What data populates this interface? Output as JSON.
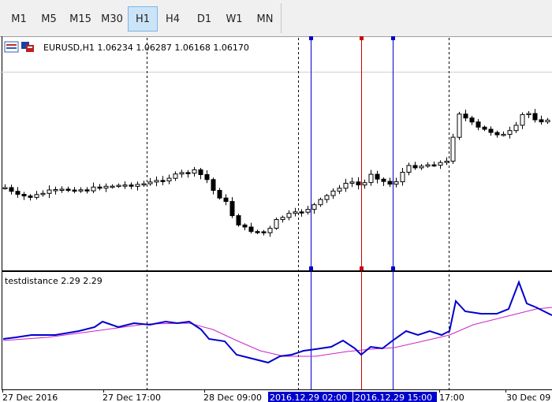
{
  "toolbar": {
    "timeframes": [
      "M1",
      "M5",
      "M15",
      "M30",
      "H1",
      "H4",
      "D1",
      "W1",
      "MN"
    ],
    "active": "H1"
  },
  "main_chart": {
    "symbol_line": "EURUSD,H1  1.06234 1.06287 1.06168 1.06170"
  },
  "indicator": {
    "title": "testdistance 2.29 2.29",
    "colors": {
      "main": "#0000cc",
      "signal": "#cc22cc"
    }
  },
  "time_axis": {
    "labels": [
      "27 Dec 2016",
      "27 Dec 17:00",
      "28 Dec 09:00",
      "17:00",
      "30 Dec 09"
    ],
    "highlighted": [
      "2016.12.29 02:00",
      "2016.12.29 15:00"
    ]
  },
  "colors": {
    "blue_line": "#0000cc",
    "red_line": "#cc0000",
    "highlight_bg": "#0000cc"
  }
}
